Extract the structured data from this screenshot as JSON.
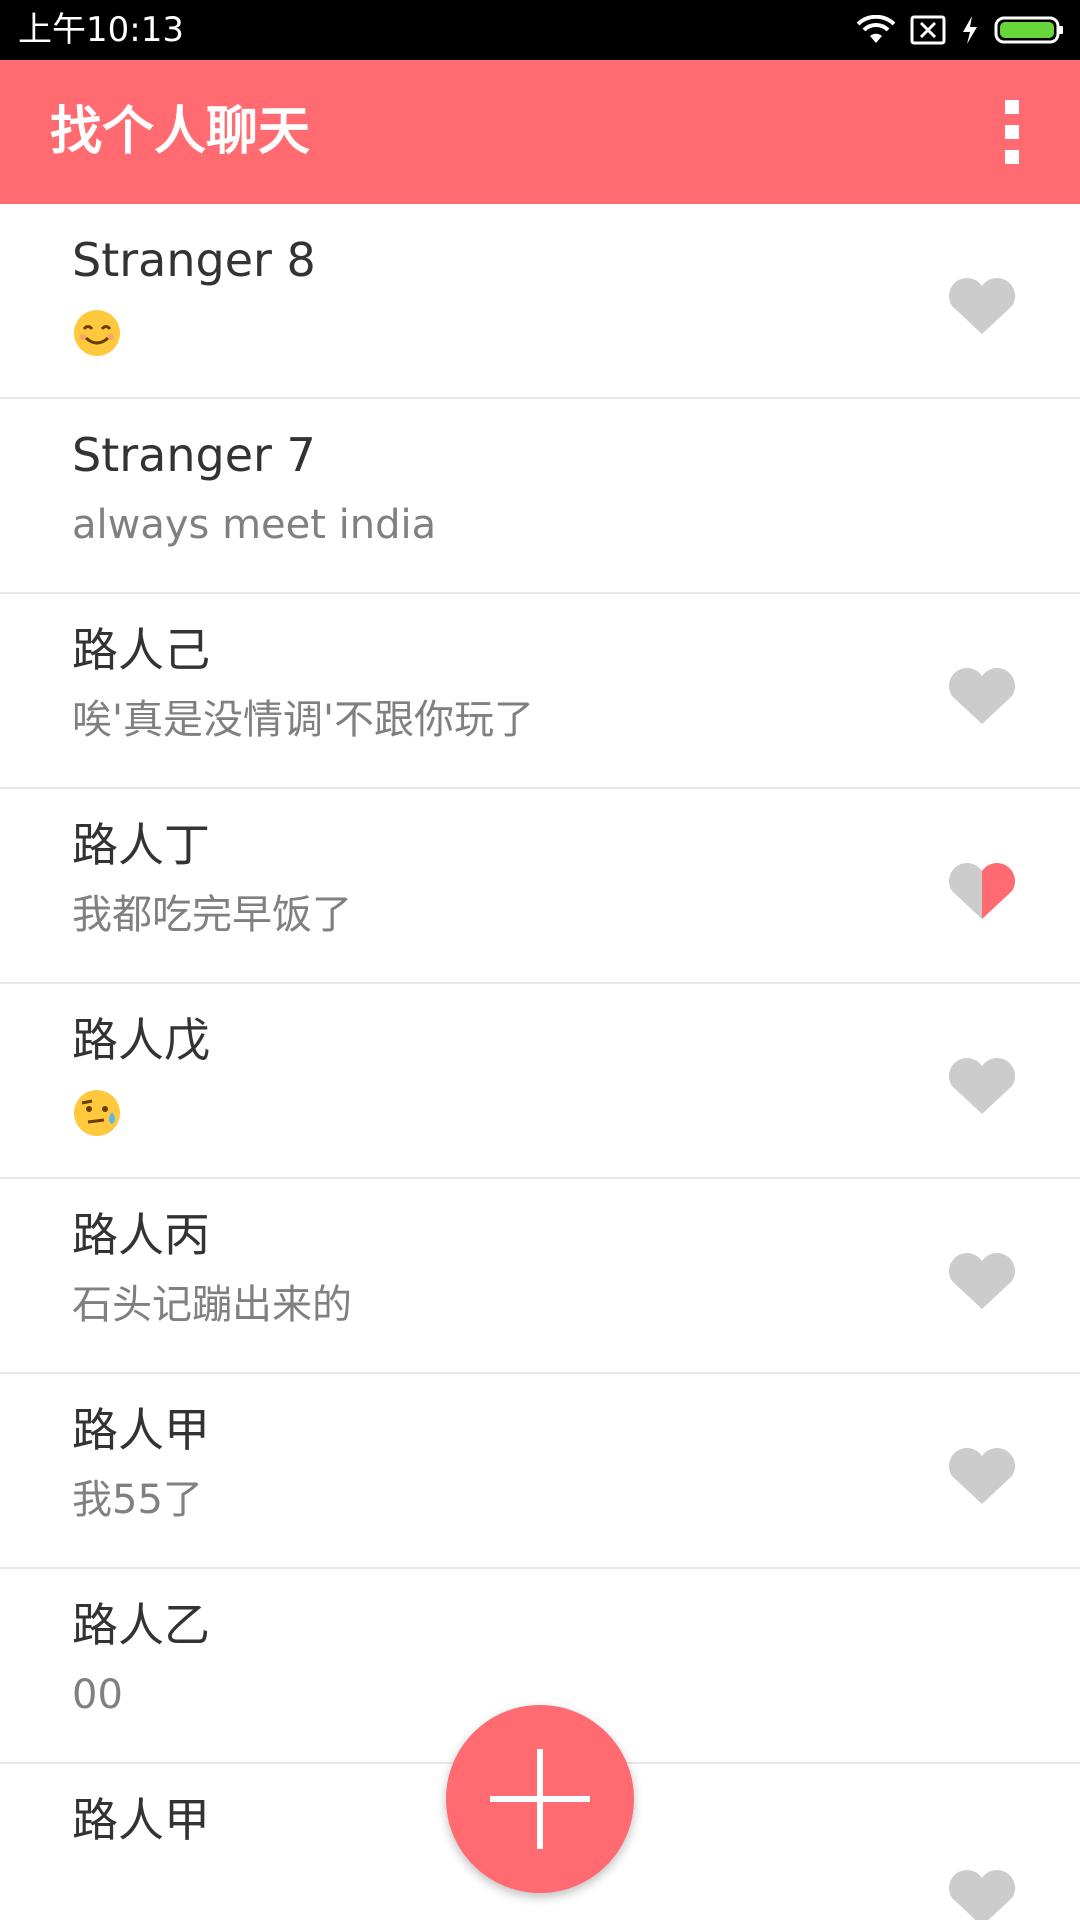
{
  "status_bar": {
    "time": "上午10:13",
    "icons": [
      "wifi-icon",
      "no-sim-icon",
      "charging-icon",
      "battery-icon"
    ],
    "battery_color": "#66d63a"
  },
  "app_bar": {
    "title": "找个人聊天",
    "menu_icon": "more-vert-icon",
    "color": "#ff6b71"
  },
  "chats": [
    {
      "name": "Stranger 8",
      "message": "",
      "emoji": "smiling-face-icon",
      "heart": "empty"
    },
    {
      "name": "Stranger 7",
      "message": "always meet india",
      "emoji": "",
      "heart": "none"
    },
    {
      "name": "路人己",
      "message": "唉'真是没情调'不跟你玩了",
      "emoji": "",
      "heart": "empty"
    },
    {
      "name": "路人丁",
      "message": "我都吃完早饭了",
      "emoji": "",
      "heart": "half"
    },
    {
      "name": "路人戊",
      "message": "",
      "emoji": "sweat-face-icon",
      "heart": "empty"
    },
    {
      "name": "路人丙",
      "message": "石头记蹦出来的",
      "emoji": "",
      "heart": "empty"
    },
    {
      "name": "路人甲",
      "message": "我55了",
      "emoji": "",
      "heart": "empty"
    },
    {
      "name": "路人乙",
      "message": "00",
      "emoji": "",
      "heart": "none"
    },
    {
      "name": "路人甲",
      "message": "",
      "emoji": "",
      "heart": "empty"
    }
  ],
  "fab": {
    "icon": "plus-icon"
  },
  "colors": {
    "heart_gray": "#cccccc",
    "heart_red": "#ff6b71",
    "name_text": "#333333",
    "message_text": "#808080"
  }
}
